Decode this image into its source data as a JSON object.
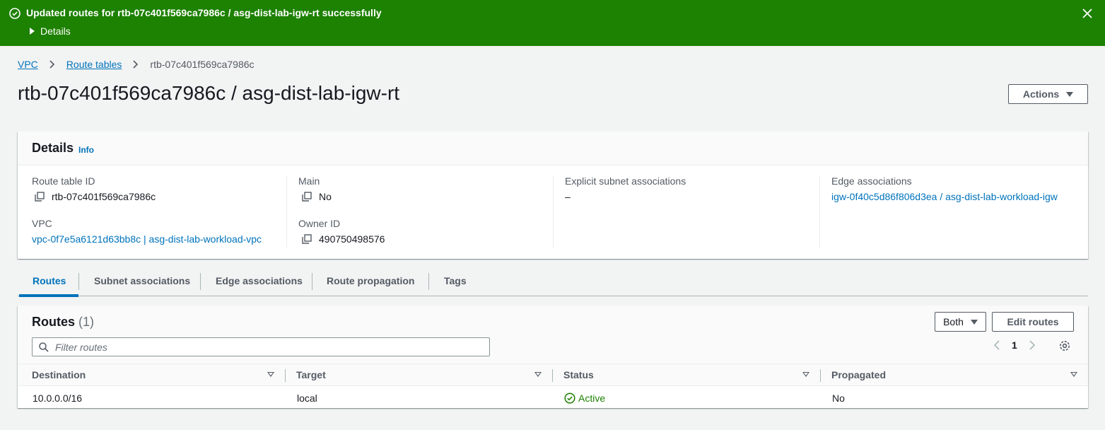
{
  "flash": {
    "message": "Updated routes for rtb-07c401f569ca7986c / asg-dist-lab-igw-rt successfully",
    "details_label": "Details"
  },
  "breadcrumb": {
    "items": [
      "VPC",
      "Route tables"
    ],
    "current": "rtb-07c401f569ca7986c"
  },
  "page": {
    "title": "rtb-07c401f569ca7986c / asg-dist-lab-igw-rt",
    "actions_label": "Actions"
  },
  "details": {
    "heading": "Details",
    "info_link": "Info",
    "route_table_id": {
      "label": "Route table ID",
      "value": "rtb-07c401f569ca7986c"
    },
    "vpc": {
      "label": "VPC",
      "value": "vpc-0f7e5a6121d63bb8c | asg-dist-lab-workload-vpc"
    },
    "main": {
      "label": "Main",
      "value": "No"
    },
    "owner_id": {
      "label": "Owner ID",
      "value": "490750498576"
    },
    "explicit_subnet": {
      "label": "Explicit subnet associations",
      "value": "–"
    },
    "edge": {
      "label": "Edge associations",
      "value": "igw-0f40c5d86f806d3ea / asg-dist-lab-workload-igw"
    }
  },
  "tabs": [
    {
      "label": "Routes",
      "active": true
    },
    {
      "label": "Subnet associations",
      "active": false
    },
    {
      "label": "Edge associations",
      "active": false
    },
    {
      "label": "Route propagation",
      "active": false
    },
    {
      "label": "Tags",
      "active": false
    }
  ],
  "routes": {
    "title": "Routes",
    "count": "(1)",
    "filter_placeholder": "Filter routes",
    "select_value": "Both",
    "edit_label": "Edit routes",
    "page": "1",
    "columns": [
      "Destination",
      "Target",
      "Status",
      "Propagated"
    ],
    "rows": [
      {
        "destination": "10.0.0.0/16",
        "target": "local",
        "status": "Active",
        "propagated": "No"
      }
    ]
  },
  "colors": {
    "success": "#1d8102",
    "link": "#0073bb",
    "background": "#f2f3f3"
  }
}
